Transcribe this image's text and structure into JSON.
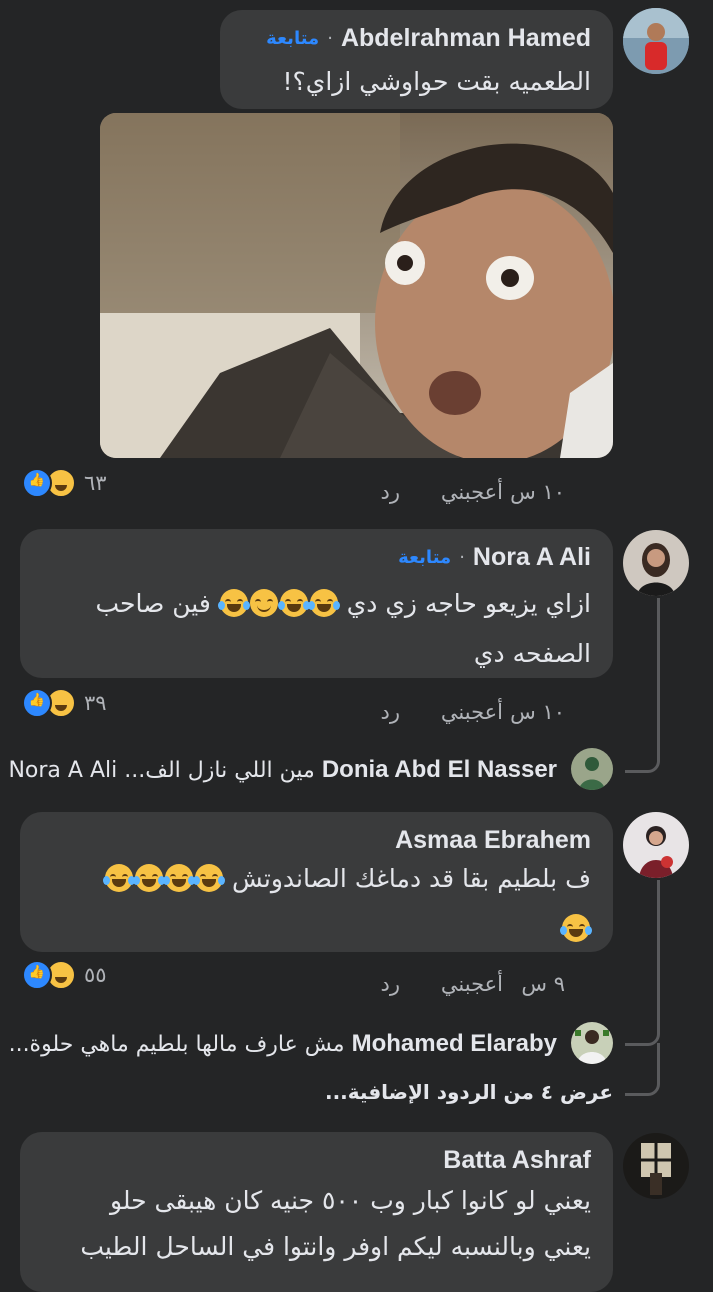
{
  "comments": [
    {
      "author": "Abdelrahman Hamed",
      "follow_label": "متابعة",
      "text": "الطعميه بقت حواوشي ازاي؟!",
      "time": "١٠ س",
      "like_label": "أعجبني",
      "reply_label": "رد",
      "reaction_count": "٦٣",
      "photo_name": "meme-photo"
    },
    {
      "author": "Nora A Ali",
      "follow_label": "متابعة",
      "text_line1_part1": "ازاي يزيعو حاجه زي دي",
      "text_line1_part2": "فين صاحب",
      "text_line2": "الصفحه دي",
      "time": "١٠ س",
      "like_label": "أعجبني",
      "reply_label": "رد",
      "reaction_count": "٣٩",
      "reply_preview": {
        "author": "Donia Abd El Nasser",
        "text": "مين اللي نازل الف... Nora A Ali"
      }
    },
    {
      "author": "Asmaa Ebrahem",
      "text_line1": "ف بلطيم بقا قد دماغك الصاندوتش",
      "time": "٩ س",
      "like_label": "أعجبني",
      "reply_label": "رد",
      "reaction_count": "٥٥",
      "reply_preview": {
        "author": "Mohamed Elaraby",
        "text": "مش عارف مالها بلطيم ماهي حلوة..."
      },
      "more_replies": "عرض ٤ من الردود الإضافية..."
    },
    {
      "author": "Batta Ashraf",
      "text_line1": "يعني لو كانوا كبار وب ٥٠٠ جنيه كان هيبقى حلو",
      "text_line2": "يعني وبالنسبه ليكم اوفر  وانتوا في الساحل الطيب"
    }
  ],
  "icons": [
    "like-reaction-icon",
    "haha-reaction-icon",
    "laughing-emoji",
    "smiling-emoji"
  ],
  "colors": {
    "background": "#242526",
    "bubble": "#3a3b3c",
    "follow": "#2d88ff",
    "text": "#e4e6eb",
    "meta": "#b0b3b8"
  }
}
